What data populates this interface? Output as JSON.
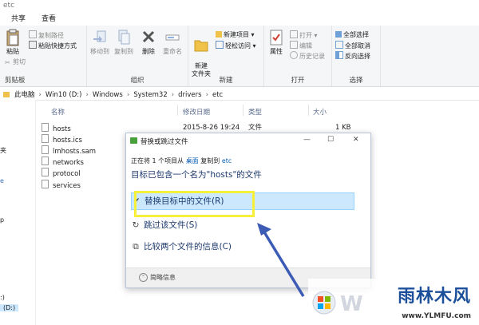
{
  "window": {
    "title": "etc"
  },
  "tabs": [
    {
      "label": "共享"
    },
    {
      "label": "查看"
    }
  ],
  "ribbon": {
    "clipboard": {
      "paste": "粘贴",
      "copy_path": "复制路径",
      "paste_shortcut": "粘贴快捷方式",
      "cut": "剪切",
      "label": "剪贴板"
    },
    "organize": {
      "move_to": "移动到",
      "copy_to": "复制到",
      "delete": "删除",
      "rename": "重命名",
      "label": "组织"
    },
    "new": {
      "new_folder": "新建\n文件夹",
      "new_item": "新建项目 ▾",
      "easy_access": "轻松访问 ▾",
      "label": "新建"
    },
    "open": {
      "properties": "属性",
      "open": "打开 ▾",
      "edit": "编辑",
      "history": "历史记录",
      "label": "打开"
    },
    "select": {
      "select_all": "全部选择",
      "select_none": "全部取消",
      "invert": "反向选择",
      "label": "选择"
    }
  },
  "address": {
    "crumbs": [
      "此电脑",
      "Win10 (D:)",
      "Windows",
      "System32",
      "drivers",
      "etc"
    ]
  },
  "nav": {
    "items": [
      "夹",
      "e",
      "p",
      ":)",
      "(D:)"
    ]
  },
  "columns": {
    "name": "名称",
    "date": "修改日期",
    "type": "类型",
    "size": "大小"
  },
  "files": [
    {
      "name": "hosts",
      "date": "2015-8-26 19:24",
      "type": "文件",
      "size": "1 KB"
    },
    {
      "name": "hosts.ics",
      "date": "",
      "type": "",
      "size": ""
    },
    {
      "name": "lmhosts.sam",
      "date": "",
      "type": "",
      "size": ""
    },
    {
      "name": "networks",
      "date": "",
      "type": "",
      "size": ""
    },
    {
      "name": "protocol",
      "date": "",
      "type": "",
      "size": ""
    },
    {
      "name": "services",
      "date": "",
      "type": "",
      "size": ""
    }
  ],
  "dialog": {
    "title": "替换或跳过文件",
    "min": "—",
    "max": "☐",
    "close": "✕",
    "status_prefix": "正在将 1 个项目从",
    "status_src": "桌面",
    "status_mid": "复制到",
    "status_dst": "etc",
    "message": "目标已包含一个名为\"hosts\"的文件",
    "options": [
      {
        "icon": "✔",
        "label": "替换目标中的文件(R)"
      },
      {
        "icon": "↻",
        "label": "跳过该文件(S)"
      },
      {
        "icon": "⧉",
        "label": "比较两个文件的信息(C)"
      }
    ],
    "footer": "简略信息"
  },
  "watermark": {
    "brand": "雨林木风",
    "url": "www.YLMFU.com"
  },
  "colors": {
    "highlight": "#f6f03a",
    "arrow": "#3b5bb5",
    "selected": "#cce8ff"
  }
}
